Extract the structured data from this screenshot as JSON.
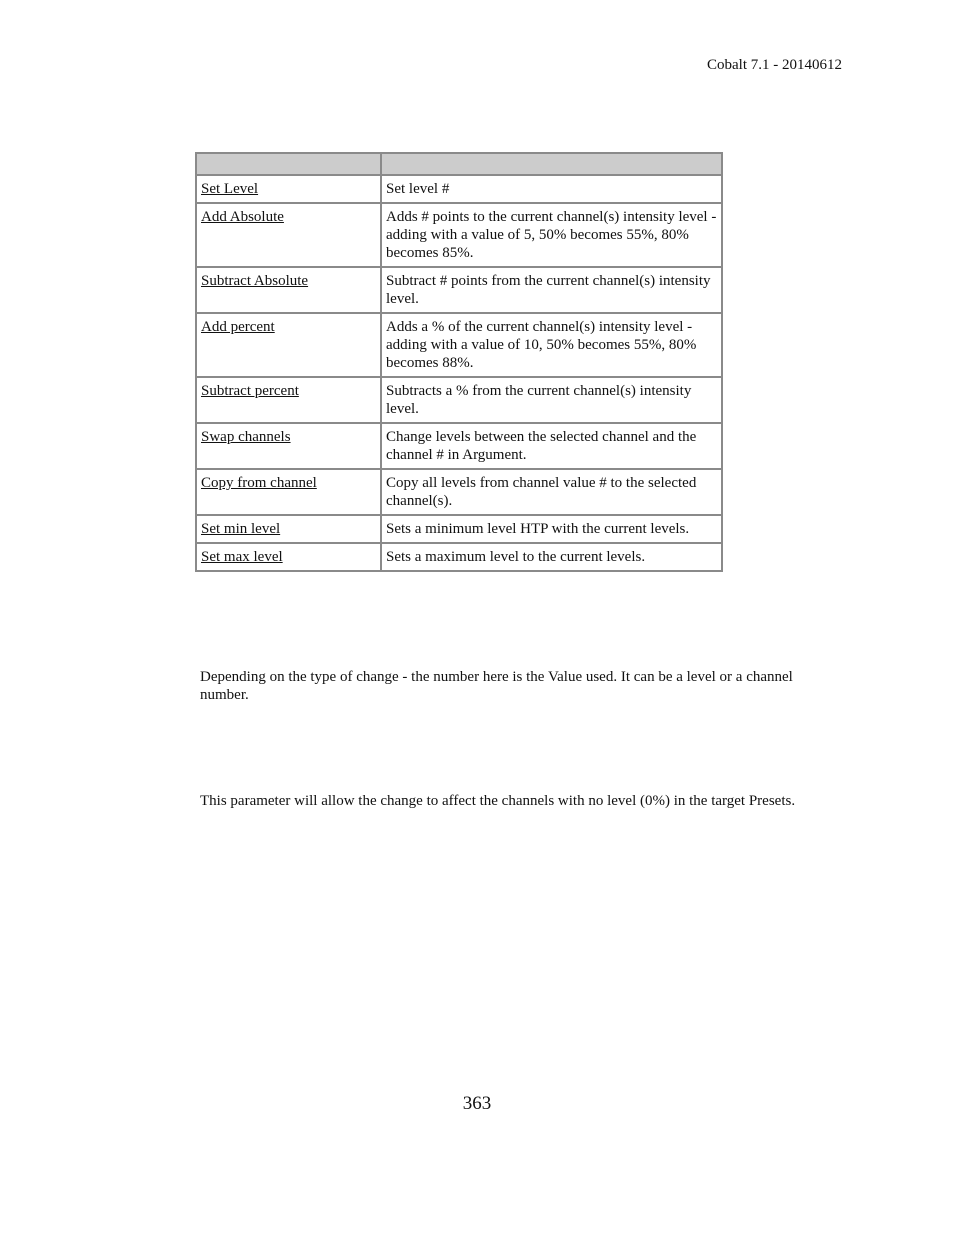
{
  "header": {
    "doc_version": "Cobalt 7.1 - 20140612"
  },
  "table": {
    "headers": [
      "",
      ""
    ],
    "rows": [
      {
        "change": "Set Level",
        "description": "Set level #"
      },
      {
        "change": "Add Absolute",
        "description": "Adds # points to the current channel(s) intensity level - adding with a value of 5, 50% becomes 55%, 80% becomes 85%."
      },
      {
        "change": "Subtract Absolute",
        "description": "Subtract # points from the current channel(s) intensity level."
      },
      {
        "change": "Add percent",
        "description": "Adds a % of the current channel(s) intensity level - adding with a value of 10, 50% becomes 55%, 80% becomes 88%."
      },
      {
        "change": "Subtract percent",
        "description": "Subtracts a % from the current channel(s) intensity level."
      },
      {
        "change": "Swap channels",
        "description": "Change levels between the selected channel and the channel # in Argument."
      },
      {
        "change": "Copy from channel",
        "description": "Copy all levels from channel value # to the selected channel(s)."
      },
      {
        "change": "Set min level",
        "description": "Sets a minimum level HTP with the current levels."
      },
      {
        "change": "Set max level",
        "description": "Sets a maximum level to the current levels."
      }
    ]
  },
  "paragraphs": {
    "value_description": "Depending on the type of change - the number here is the Value used. It can be a level or a channel number.",
    "zero_description": "This parameter will allow the change to affect the channels with no level (0%) in the target Presets."
  },
  "footer": {
    "page_number": "363"
  }
}
